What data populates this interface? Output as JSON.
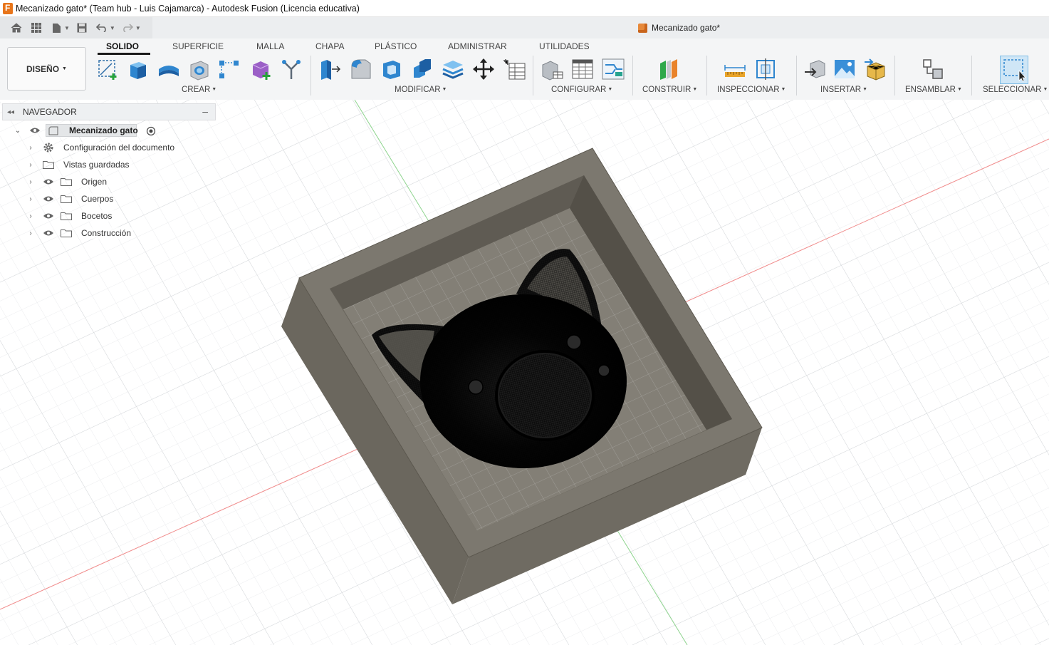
{
  "window": {
    "title": "Mecanizado gato* (Team hub - Luis Cajamarca) - Autodesk Fusion (Licencia educativa)"
  },
  "quick_access": {
    "document_tab": "Mecanizado gato*",
    "icons": [
      "home-icon",
      "grid-icon",
      "file-icon",
      "save-icon",
      "undo-icon",
      "redo-icon"
    ]
  },
  "ribbon": {
    "workspace": "DISEÑO",
    "tabs": [
      "SOLIDO",
      "SUPERFICIE",
      "MALLA",
      "CHAPA",
      "PLÁSTICO",
      "ADMINISTRAR",
      "UTILIDADES"
    ],
    "active_tab": "SOLIDO",
    "groups": [
      "CREAR",
      "MODIFICAR",
      "CONFIGURAR",
      "CONSTRUIR",
      "INSPECCIONAR",
      "INSERTAR",
      "ENSAMBLAR",
      "SELECCIONAR"
    ],
    "accent": "#0696d7"
  },
  "navigator": {
    "title": "NAVEGADOR",
    "root": "Mecanizado gato",
    "items": [
      {
        "label": "Configuración del documento",
        "icon": "gear-icon"
      },
      {
        "label": "Vistas guardadas",
        "icon": "folder-icon"
      },
      {
        "label": "Origen",
        "icon": "folder-icon"
      },
      {
        "label": "Cuerpos",
        "icon": "folder-icon"
      },
      {
        "label": "Bocetos",
        "icon": "folder-icon"
      },
      {
        "label": "Construcción",
        "icon": "folder-icon"
      }
    ]
  },
  "viewport": {
    "model_color": "#7c786f",
    "grid_color": "#dfe1e3"
  }
}
